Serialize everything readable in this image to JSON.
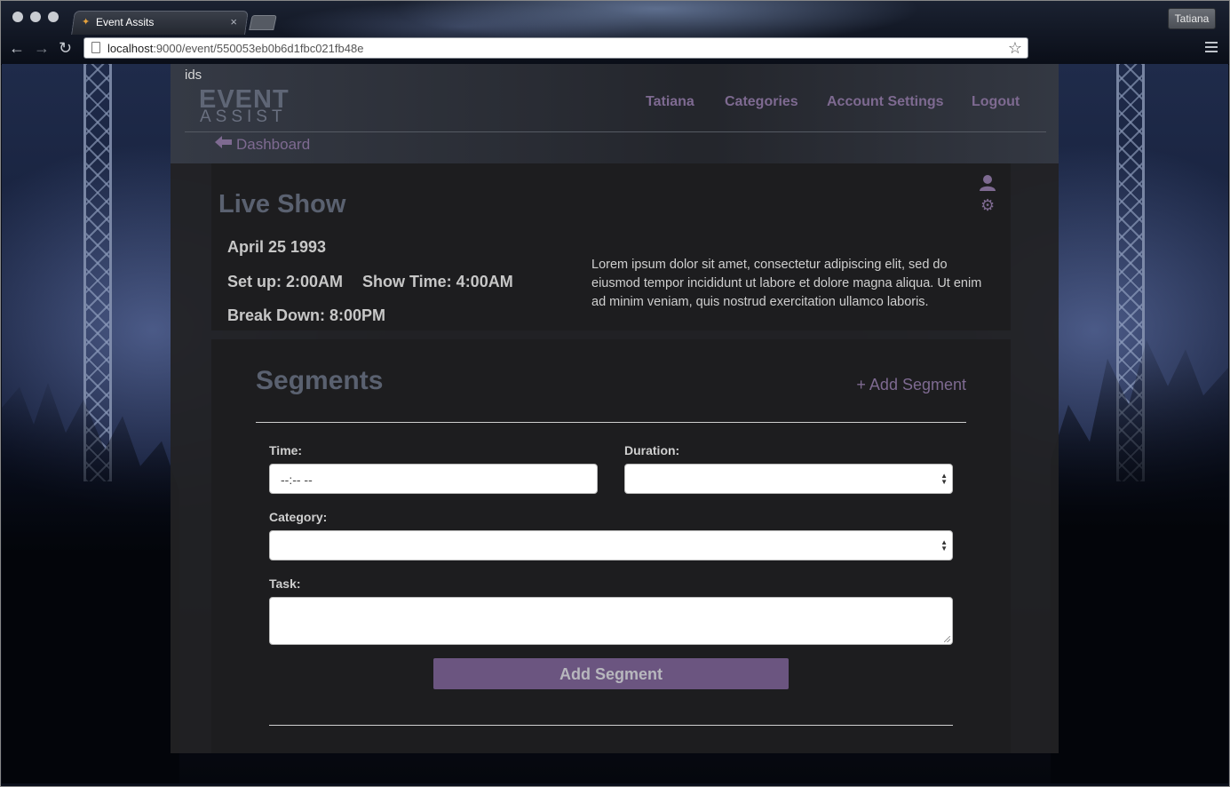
{
  "browser": {
    "tab_title": "Event Assits",
    "profile_name": "Tatiana",
    "url_host": "localhost",
    "url_rest": ":9000/event/550053eb0b6d1fbc021fb48e"
  },
  "page": {
    "stray_text": "ids"
  },
  "logo": {
    "line1": "EVENT",
    "line2": "ASSIST"
  },
  "nav": {
    "items": [
      "Tatiana",
      "Categories",
      "Account Settings",
      "Logout"
    ],
    "back_label": "Dashboard"
  },
  "event": {
    "title": "Live Show",
    "date": "April 25 1993",
    "setup": "Set up: 2:00AM",
    "show_time": "Show Time: 4:00AM",
    "break_down": "Break Down: 8:00PM",
    "description": "Lorem ipsum dolor sit amet, consectetur adipiscing elit, sed do eiusmod tempor incididunt ut labore et dolore magna aliqua. Ut enim ad minim veniam, quis nostrud exercitation ullamco laboris."
  },
  "segments": {
    "title": "Segments",
    "add_link": "+ Add Segment",
    "form": {
      "time_label": "Time:",
      "time_value": "--:-- --",
      "duration_label": "Duration:",
      "duration_value": "",
      "category_label": "Category:",
      "category_value": "",
      "task_label": "Task:",
      "task_value": "",
      "submit_label": "Add Segment"
    }
  },
  "colors": {
    "accent": "#7e6a91",
    "button": "#6b5580",
    "heading": "#5a6170",
    "card": "#1d1d1f"
  },
  "icons": [
    "back-icon",
    "forward-icon",
    "reload-icon",
    "page-icon",
    "star-icon",
    "menu-icon",
    "arrow-left-icon",
    "user-icon",
    "gear-icon"
  ]
}
